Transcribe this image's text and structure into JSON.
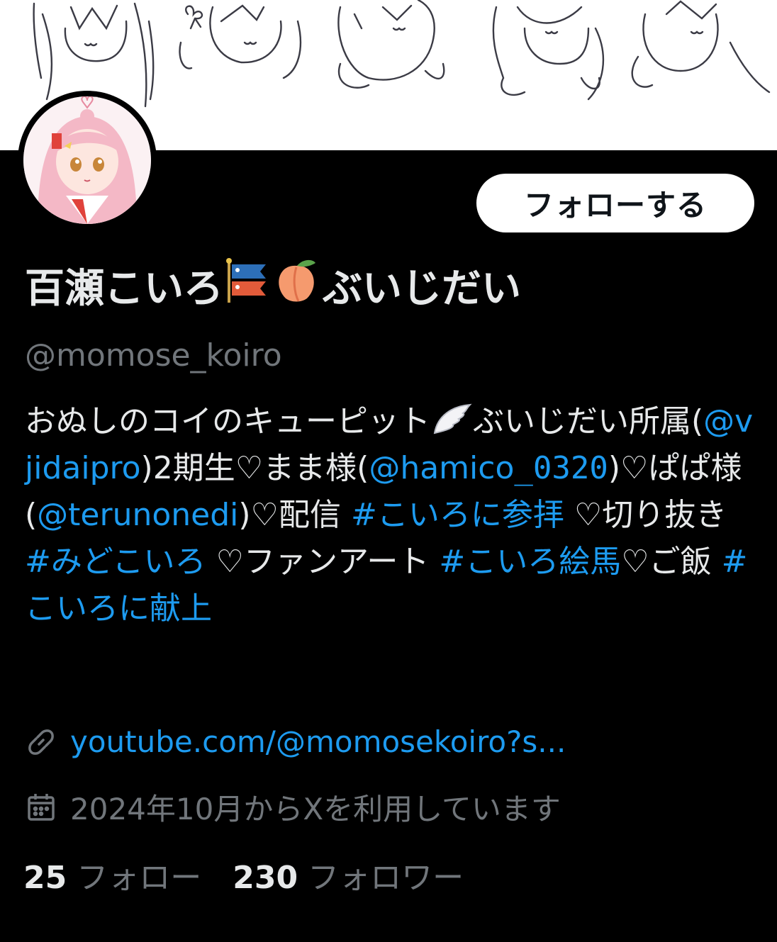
{
  "profile": {
    "display_name": "百瀬こいろ",
    "display_name_suffix": "ぶいじだい",
    "name_emojis": [
      "koinobori-icon",
      "peach-icon"
    ],
    "handle": "@momose_koiro",
    "follow_button": "フォローする"
  },
  "bio": {
    "line1_text": "おぬしのコイのキューピット",
    "line1_tail": "ぶいじだい",
    "affiliation": "所属(",
    "mention_vjidaipro": "@vjidaipro",
    "after_vjidai": ")2期生♡まま様(",
    "mention_hamico": "@hamico",
    "mention_hamico_tail": "_0320",
    "after_hamico": ")♡ぱぱ様(",
    "mention_terunonedi": "@terunonedi",
    "after_teru": ")♡配信 ",
    "hashtag_sanpai": "#こいろに参拝",
    "kirinuki": " ♡切り抜き ",
    "hashtag_midokoiro": "#みどこいろ",
    "fanart": " ♡ファンアート ",
    "hashtag_ema": "#こいろ絵馬",
    "gohan": "♡ご飯 ",
    "hashtag_kenjou": "#こいろに献上"
  },
  "meta": {
    "link_text": "youtube.com/@momosekoiro?s...",
    "joined_text": "2024年10月からXを利用しています"
  },
  "stats": {
    "following_count": "25",
    "following_label": "フォロー",
    "followers_count": "230",
    "followers_label": "フォロワー"
  },
  "colors": {
    "background": "#000000",
    "text": "#e7e9ea",
    "secondary": "#71767b",
    "link": "#1d9bf0",
    "button_bg": "#ffffff"
  }
}
